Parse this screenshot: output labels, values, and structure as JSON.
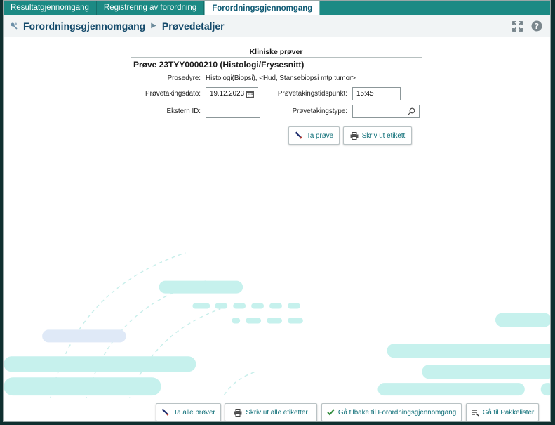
{
  "tabs": [
    {
      "label": "Resultatgjennomgang"
    },
    {
      "label": "Registrering av forordning"
    },
    {
      "label": "Forordningsgjennomgang",
      "active": true
    }
  ],
  "breadcrumb": {
    "root": "Forordningsgjennomgang",
    "current": "Prøvedetaljer"
  },
  "section": {
    "title": "Kliniske prøver",
    "sample_title": "Prøve 23TYY0000210 (Histologi/Frysesnitt)"
  },
  "form": {
    "procedure_label": "Prosedyre:",
    "procedure_value": "Histologi(Biopsi), <Hud, Stansebiopsi mtp tumor>",
    "date_label": "Prøvetakingsdato:",
    "date_value": "19.12.2023",
    "time_label": "Prøvetakingstidspunkt:",
    "time_value": "15:45",
    "external_id_label": "Ekstern ID:",
    "external_id_value": "",
    "sample_type_label": "Prøvetakingstype:",
    "sample_type_value": ""
  },
  "actions": {
    "take_sample": "Ta prøve",
    "print_label": "Skriv ut etikett"
  },
  "footer": {
    "take_all": "Ta alle prøver",
    "print_all": "Skriv ut alle etiketter",
    "back": "Gå tilbake til Forordningsgjennomgang",
    "packlists": "Gå til Pakkelister"
  },
  "colors": {
    "tabbar": "#1c8a84",
    "accent_text": "#0d6e77",
    "breadcrumb": "#13496a",
    "decoration_teal": "#bff0ec",
    "decoration_blue": "#dce9f7"
  }
}
